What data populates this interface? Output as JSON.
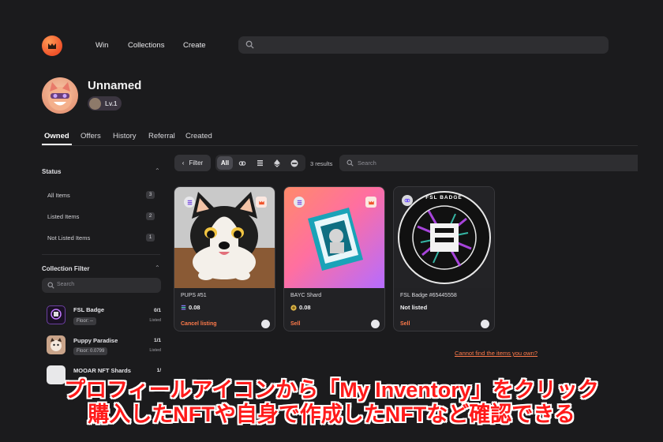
{
  "nav": {
    "win": "Win",
    "collections": "Collections",
    "create": "Create"
  },
  "profile": {
    "name": "Unnamed",
    "level": "Lv.1"
  },
  "tabs": [
    "Owned",
    "Offers",
    "History",
    "Referral",
    "Created"
  ],
  "sidebar": {
    "status_title": "Status",
    "status_items": [
      {
        "label": "All Items",
        "count": "3"
      },
      {
        "label": "Listed Items",
        "count": "2"
      },
      {
        "label": "Not Listed Items",
        "count": "1"
      }
    ],
    "collection_title": "Collection Filter",
    "search_placeholder": "Search",
    "collections": [
      {
        "name": "FSL Badge",
        "floor": "Floor: --",
        "fraction": "0/1",
        "status": "Listed"
      },
      {
        "name": "Puppy Paradise",
        "floor": "Floor: 0.0799",
        "fraction": "1/1",
        "status": "Listed"
      },
      {
        "name": "MOOAR NFT Shards",
        "fraction": "1/"
      }
    ]
  },
  "toolbar": {
    "filter": "Filter",
    "all": "All",
    "results": "3 results",
    "search_placeholder": "Search"
  },
  "cards": [
    {
      "name": "PUPS #51",
      "price": "0.08",
      "action": "Cancel listing"
    },
    {
      "name": "BAYC Shard",
      "price": "0.08",
      "action": "Sell"
    },
    {
      "name": "FSL Badge #65445558",
      "price": "Not listed",
      "action": "Sell"
    }
  ],
  "badge_text": {
    "fsl_badge": "FSL BADGE"
  },
  "cant_find": "Cannot find the items you own?",
  "overlay": {
    "line1": "プロフィールアイコンから「My Inventory」をクリック",
    "line2": "購入したNFTや自身で作成したNFTなど確認できる"
  },
  "colors": {
    "accent": "#ff7a4a",
    "background": "#1b1b1d",
    "overlay_text": "#ff1a1a"
  }
}
